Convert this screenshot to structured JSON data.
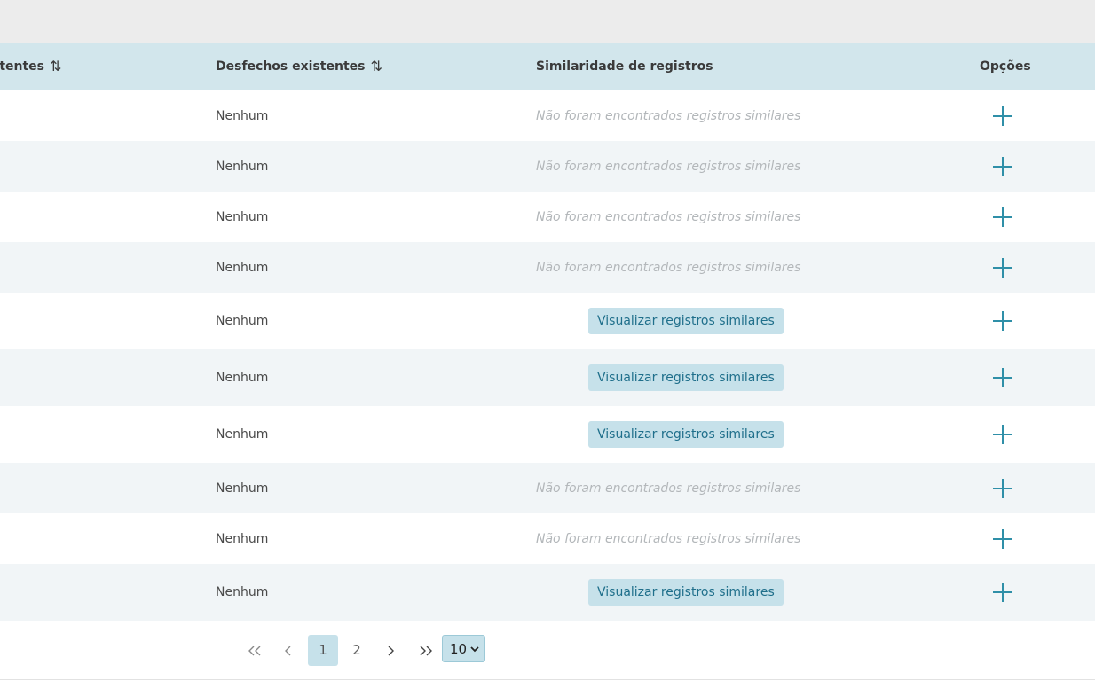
{
  "table": {
    "columns": [
      {
        "label": "stentes",
        "sortable": true
      },
      {
        "label": "Desfechos existentes",
        "sortable": true
      },
      {
        "label": "Similaridade de registros",
        "sortable": false
      },
      {
        "label": "Opções",
        "sortable": false
      }
    ],
    "sort_icon": "⇅",
    "rows": [
      {
        "outcome": "Nenhum",
        "similarity": {
          "type": "none",
          "text": "Não foram encontrados registros similares"
        }
      },
      {
        "outcome": "Nenhum",
        "similarity": {
          "type": "none",
          "text": "Não foram encontrados registros similares"
        }
      },
      {
        "outcome": "Nenhum",
        "similarity": {
          "type": "none",
          "text": "Não foram encontrados registros similares"
        }
      },
      {
        "outcome": "Nenhum",
        "similarity": {
          "type": "none",
          "text": "Não foram encontrados registros similares"
        }
      },
      {
        "outcome": "Nenhum",
        "similarity": {
          "type": "button",
          "text": "Visualizar registros similares"
        }
      },
      {
        "outcome": "Nenhum",
        "similarity": {
          "type": "button",
          "text": "Visualizar registros similares"
        }
      },
      {
        "outcome": "Nenhum",
        "similarity": {
          "type": "button",
          "text": "Visualizar registros similares"
        }
      },
      {
        "outcome": "Nenhum",
        "similarity": {
          "type": "none",
          "text": "Não foram encontrados registros similares"
        }
      },
      {
        "outcome": "Nenhum",
        "similarity": {
          "type": "none",
          "text": "Não foram encontrados registros similares"
        }
      },
      {
        "outcome": "Nenhum",
        "similarity": {
          "type": "button",
          "text": "Visualizar registros similares"
        }
      }
    ],
    "option_icon": "plus-icon"
  },
  "pagination": {
    "pages": [
      "1",
      "2"
    ],
    "current_page": "1",
    "page_size": "10"
  },
  "colors": {
    "header_bg": "#d2e6ec",
    "accent": "#2f8fa8",
    "button_bg": "#c6e1ea",
    "striped_row": "#f1f5f7"
  }
}
